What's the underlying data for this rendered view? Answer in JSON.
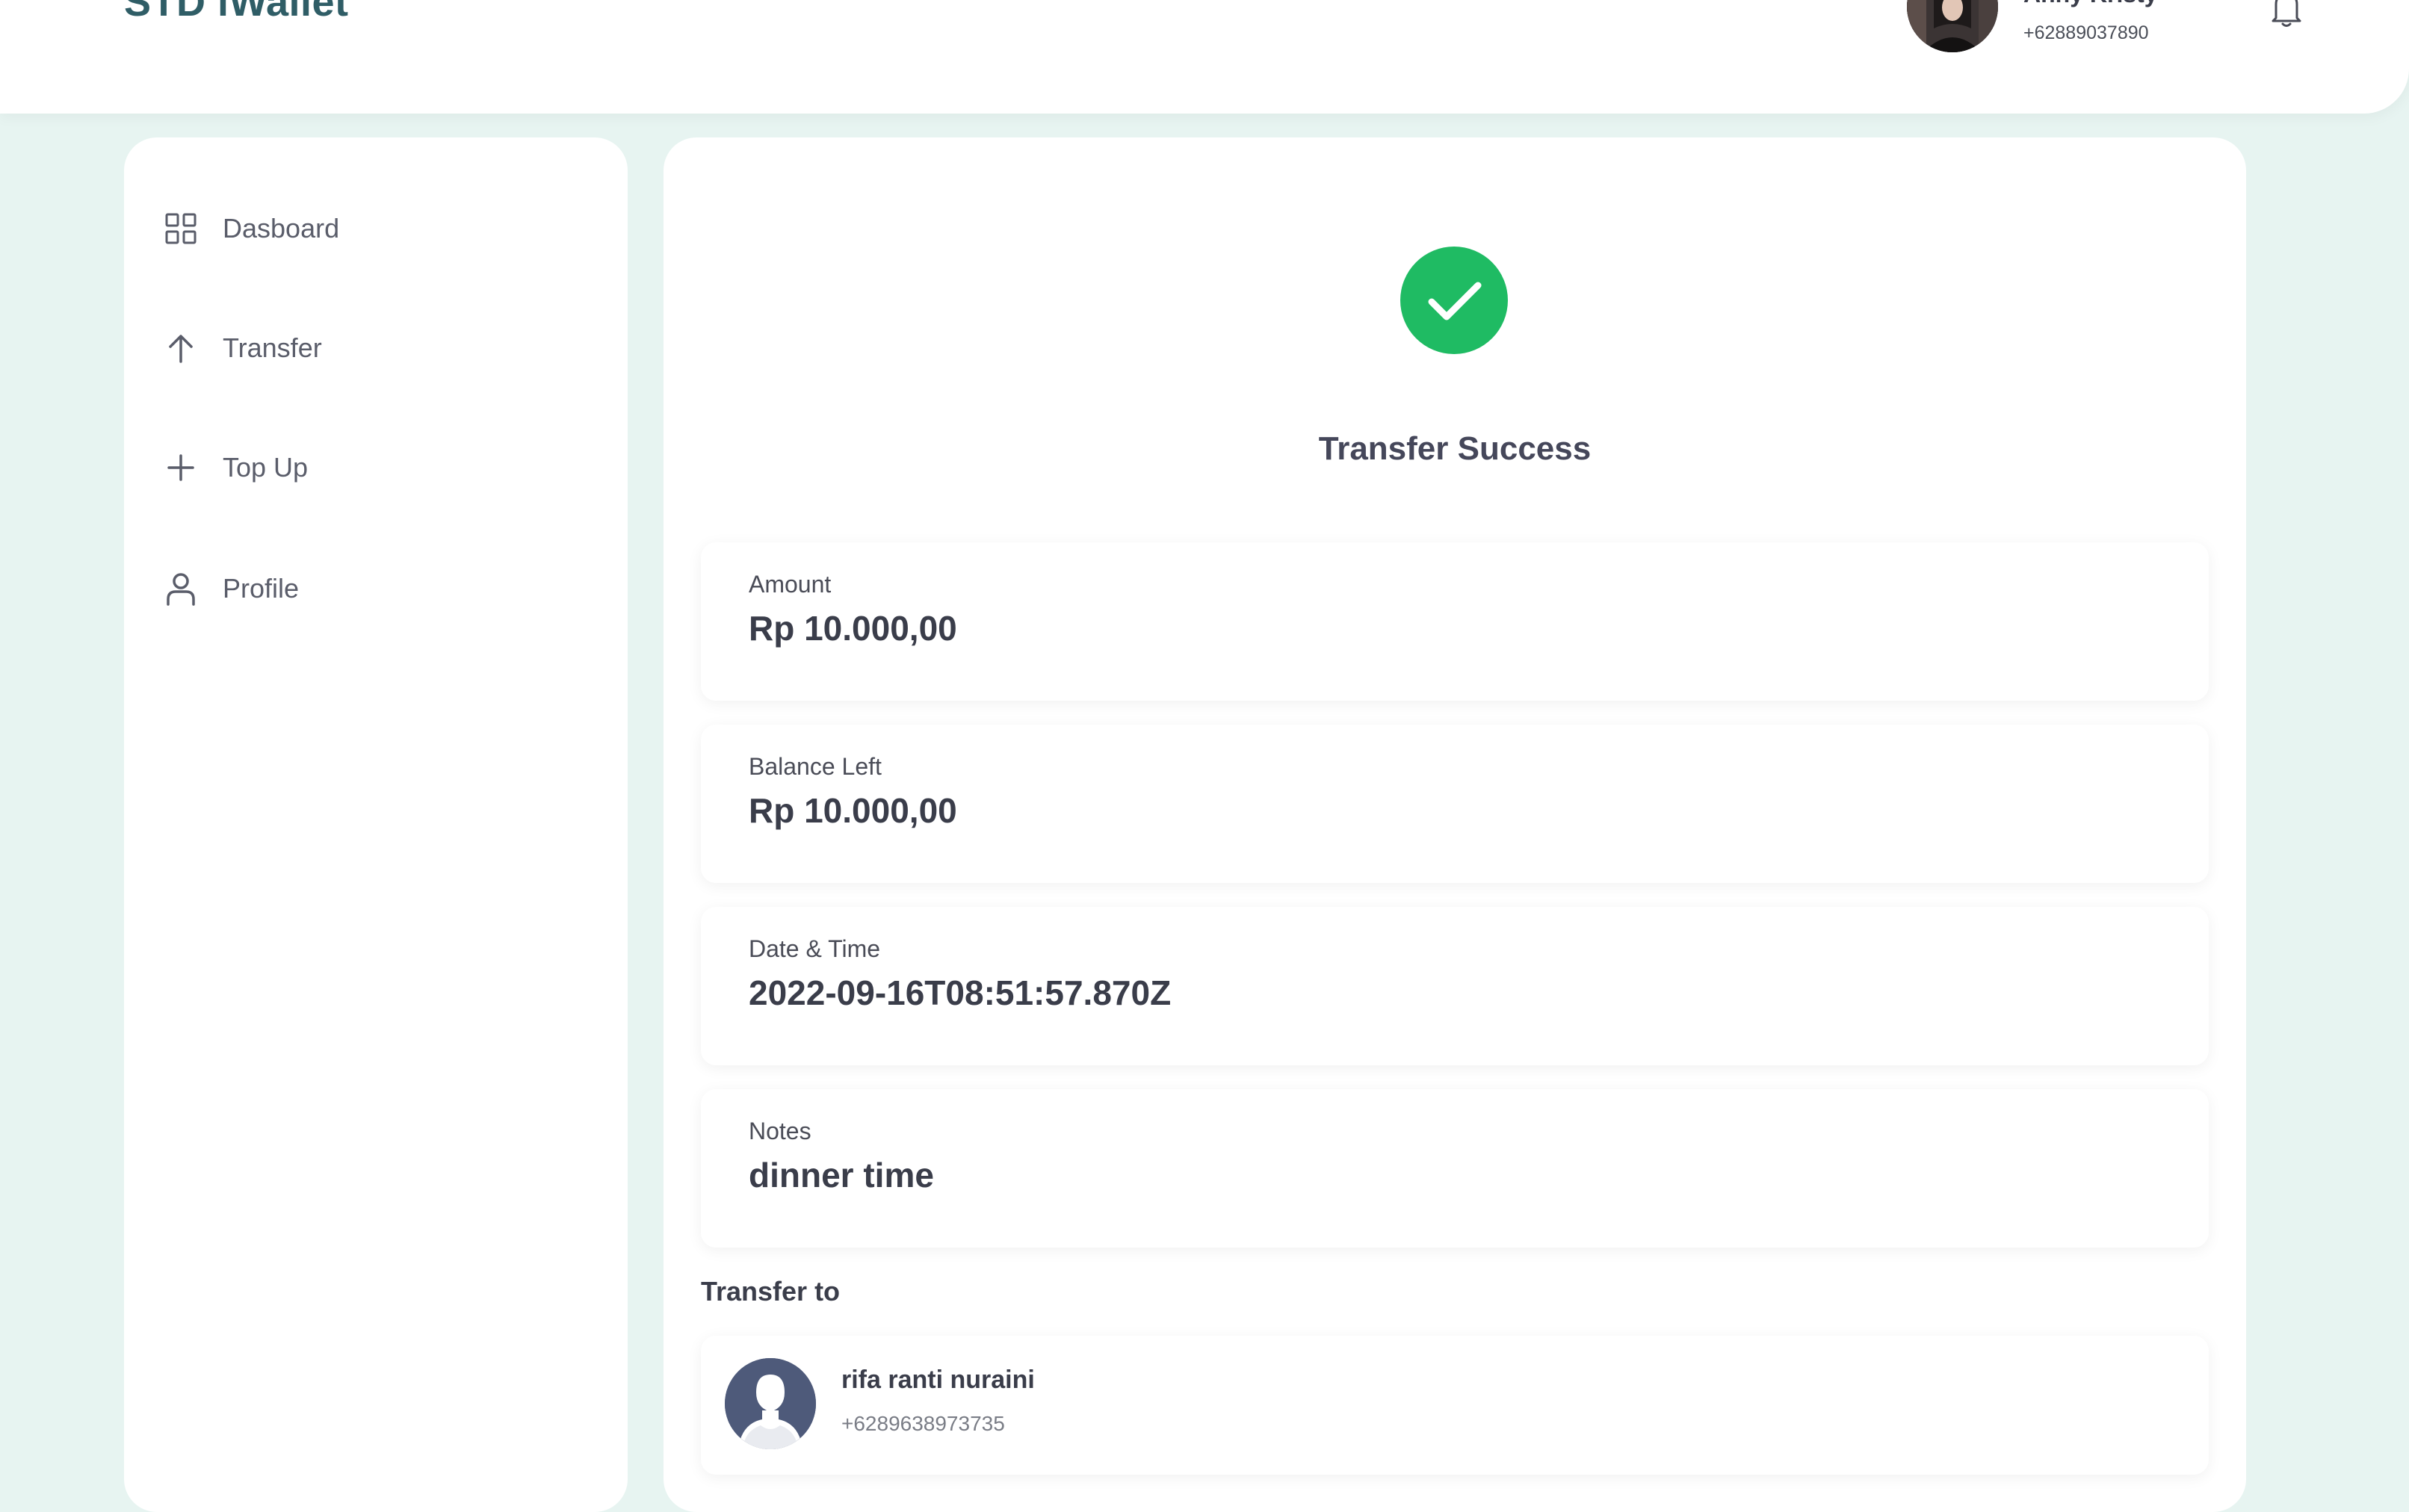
{
  "header": {
    "logo": "STD iWallet",
    "user_name": "Anny Kristy",
    "user_phone": "+62889037890"
  },
  "sidebar": {
    "items": [
      {
        "label": "Dasboard",
        "icon": "grid-icon"
      },
      {
        "label": "Transfer",
        "icon": "arrow-up-icon"
      },
      {
        "label": "Top Up",
        "icon": "plus-icon"
      },
      {
        "label": "Profile",
        "icon": "user-icon"
      }
    ]
  },
  "main": {
    "status_title": "Transfer Success",
    "details": [
      {
        "label": "Amount",
        "value": "Rp 10.000,00"
      },
      {
        "label": "Balance Left",
        "value": "Rp 10.000,00"
      },
      {
        "label": "Date & Time",
        "value": "2022-09-16T08:51:57.870Z"
      },
      {
        "label": "Notes",
        "value": "dinner time"
      }
    ],
    "transfer_to_label": "Transfer to",
    "recipient": {
      "name": "rifa ranti nuraini",
      "phone": "+6289638973735"
    }
  },
  "colors": {
    "background": "#e7f4f1",
    "brand": "#2f5d66",
    "success": "#1fbb63",
    "text_dark": "#3a3d4a"
  }
}
